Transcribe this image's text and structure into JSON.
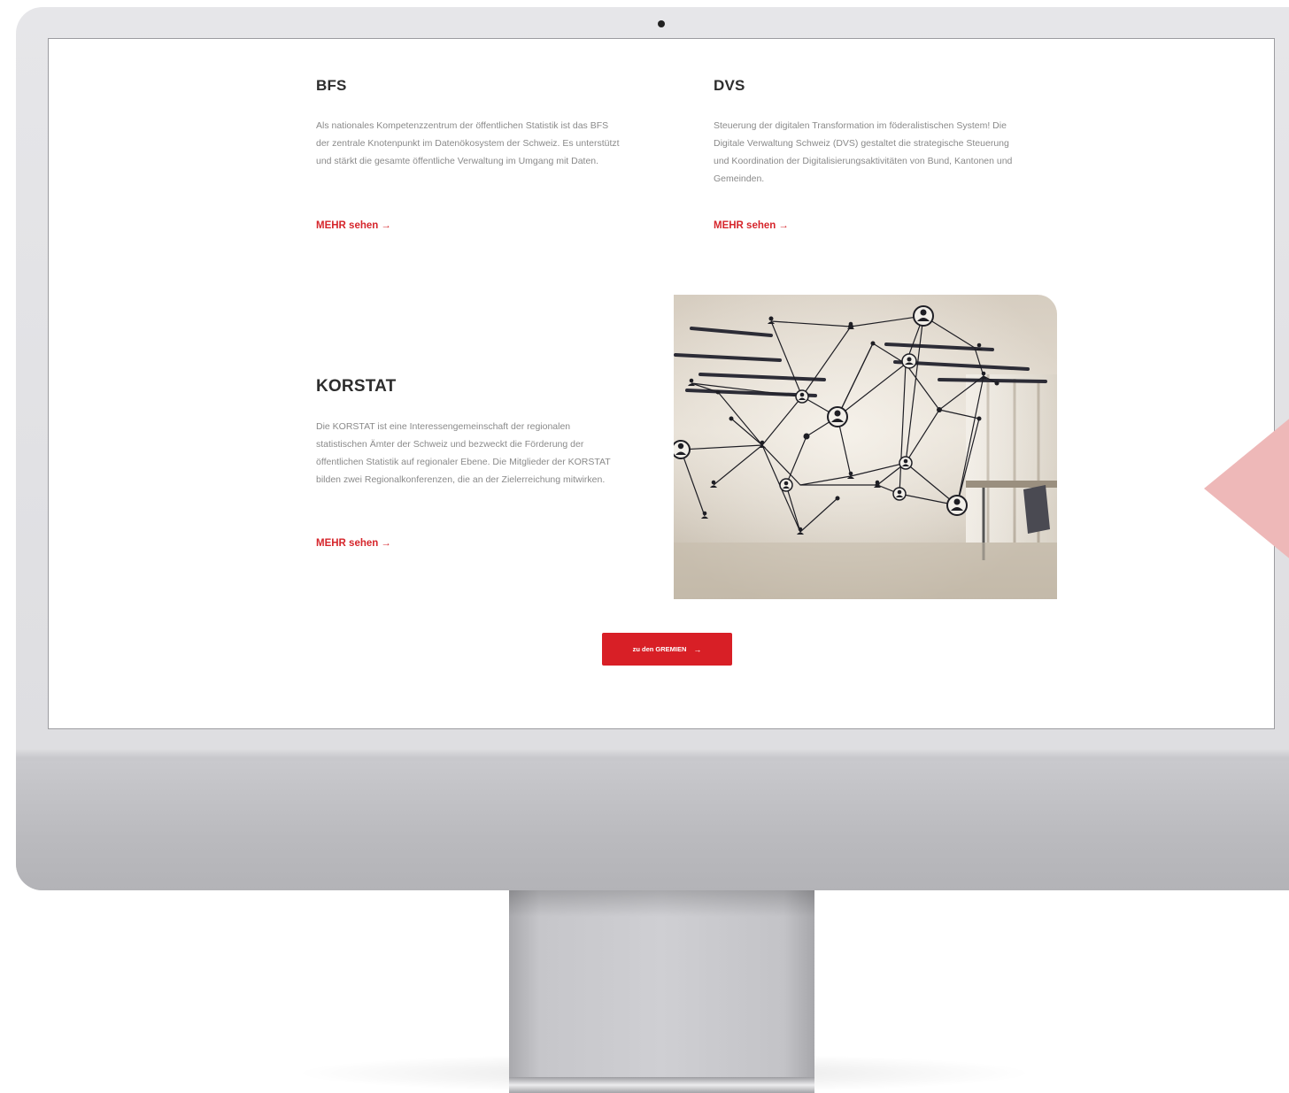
{
  "cards": {
    "bfs": {
      "title": "BFS",
      "text": "Als nationales Kompetenzzentrum der öffentlichen Statistik ist das BFS der zentrale Knotenpunkt im Datenökosystem der Schweiz. Es unterstützt und stärkt die gesamte öffentliche Verwaltung im Umgang mit Daten.",
      "link": "MEHR sehen"
    },
    "dvs": {
      "title": "DVS",
      "text": "Steuerung der digitalen Transformation im föderalistischen System! Die Digitale Verwaltung Schweiz (DVS) gestaltet die strategische Steuerung und Koordination der Digitalisierungsaktivitäten von Bund, Kantonen und Gemeinden.",
      "link": "MEHR sehen"
    },
    "korstat": {
      "title": "KORSTAT",
      "text": "Die KORSTAT ist eine Interessengemeinschaft der regionalen statistischen Ämter der Schweiz und bezweckt die Förderung der öffentlichen Statistik auf regionaler Ebene. Die Mitglieder der KORSTAT bilden zwei Regionalkonferenzen, die an der Zielerreichung mitwirken.",
      "link": "MEHR sehen"
    }
  },
  "cta": {
    "label": "zu den GREMIEN"
  },
  "icons": {
    "link_arrow": "→"
  },
  "colors": {
    "accent": "#d81f26",
    "decor": "#eeb8b8"
  }
}
